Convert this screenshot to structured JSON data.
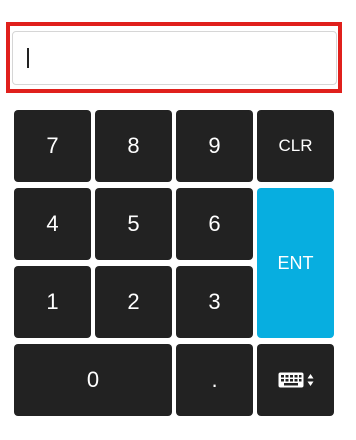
{
  "input": {
    "value": ""
  },
  "keypad": {
    "keys": {
      "k7": "7",
      "k8": "8",
      "k9": "9",
      "clr": "CLR",
      "k4": "4",
      "k5": "5",
      "k6": "6",
      "ent": "ENT",
      "k1": "1",
      "k2": "2",
      "k3": "3",
      "k0": "0",
      "dot": "."
    },
    "keyboard_toggle_icon": "keyboard-icon"
  },
  "colors": {
    "key_bg": "#222222",
    "enter_bg": "#07aee0",
    "highlight_border": "#e0201c"
  }
}
